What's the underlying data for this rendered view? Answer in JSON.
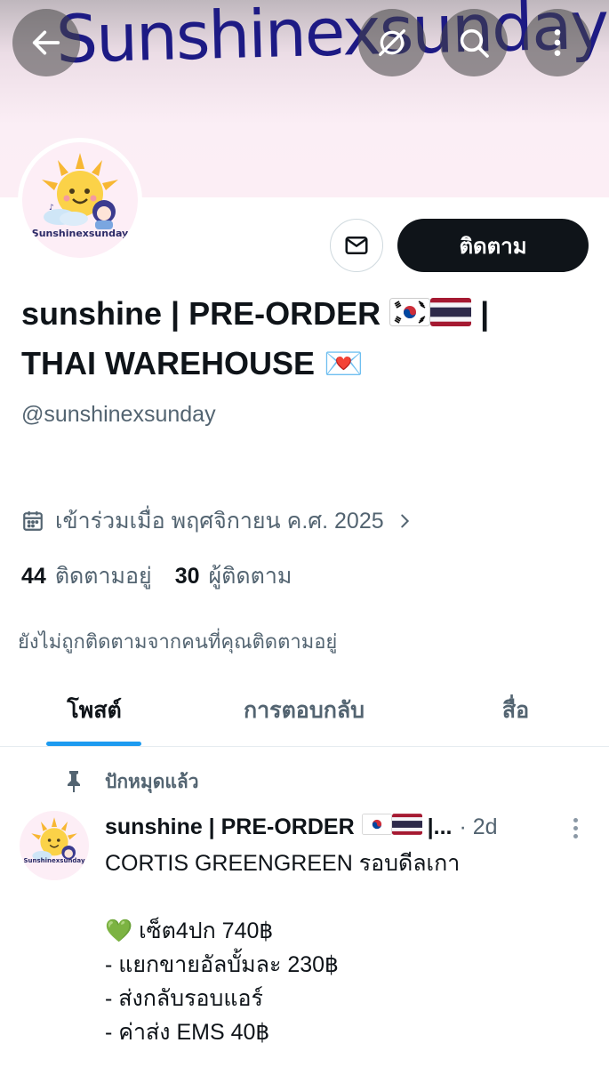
{
  "header": {
    "banner_text": "Sunshinexsunday",
    "back_icon": "arrow-left-icon",
    "grok_icon": "grok-icon",
    "search_icon": "search-icon",
    "more_icon": "more-vertical-icon"
  },
  "avatar": {
    "caption": "Sunshinexsunday"
  },
  "actions": {
    "message_icon": "envelope-icon",
    "follow_label": "ติดตาม"
  },
  "profile": {
    "name_part1": "sunshine | PRE-ORDER",
    "name_sep": "|",
    "name_part2": "THAI WAREHOUSE",
    "flags": [
      "kr-flag",
      "th-flag"
    ],
    "heart_emoji": "💌",
    "handle": "@sunshinexsunday",
    "joined": "เข้าร่วมเมื่อ พฤศจิกายน ค.ศ. 2025",
    "following_count": "44",
    "following_label": "ติดตามอยู่",
    "followers_count": "30",
    "followers_label": "ผู้ติดตาม",
    "not_followed_note": "ยังไม่ถูกติดตามจากคนที่คุณติดตามอยู่"
  },
  "tabs": [
    {
      "label": "โพสต์",
      "active": true
    },
    {
      "label": "การตอบกลับ",
      "active": false
    },
    {
      "label": "สื่อ",
      "active": false
    }
  ],
  "pinned_post": {
    "pinned_label": "ปักหมุดแล้ว",
    "author": "sunshine | PRE-ORDER",
    "author_tail": "|...",
    "time": "· 2d",
    "lines": [
      "CORTIS GREENGREEN รอบดีลเกา",
      "",
      "💚 เซ็ต4ปก 740฿",
      "- แยกขายอัลบั้มละ 230฿",
      "- ส่งกลับรอบแอร์",
      "- ค่าส่ง EMS 40฿"
    ]
  },
  "colors": {
    "accent": "#1d9bf0",
    "text_primary": "#0f1419",
    "text_secondary": "#536471",
    "follow_bg": "#0f1419"
  }
}
